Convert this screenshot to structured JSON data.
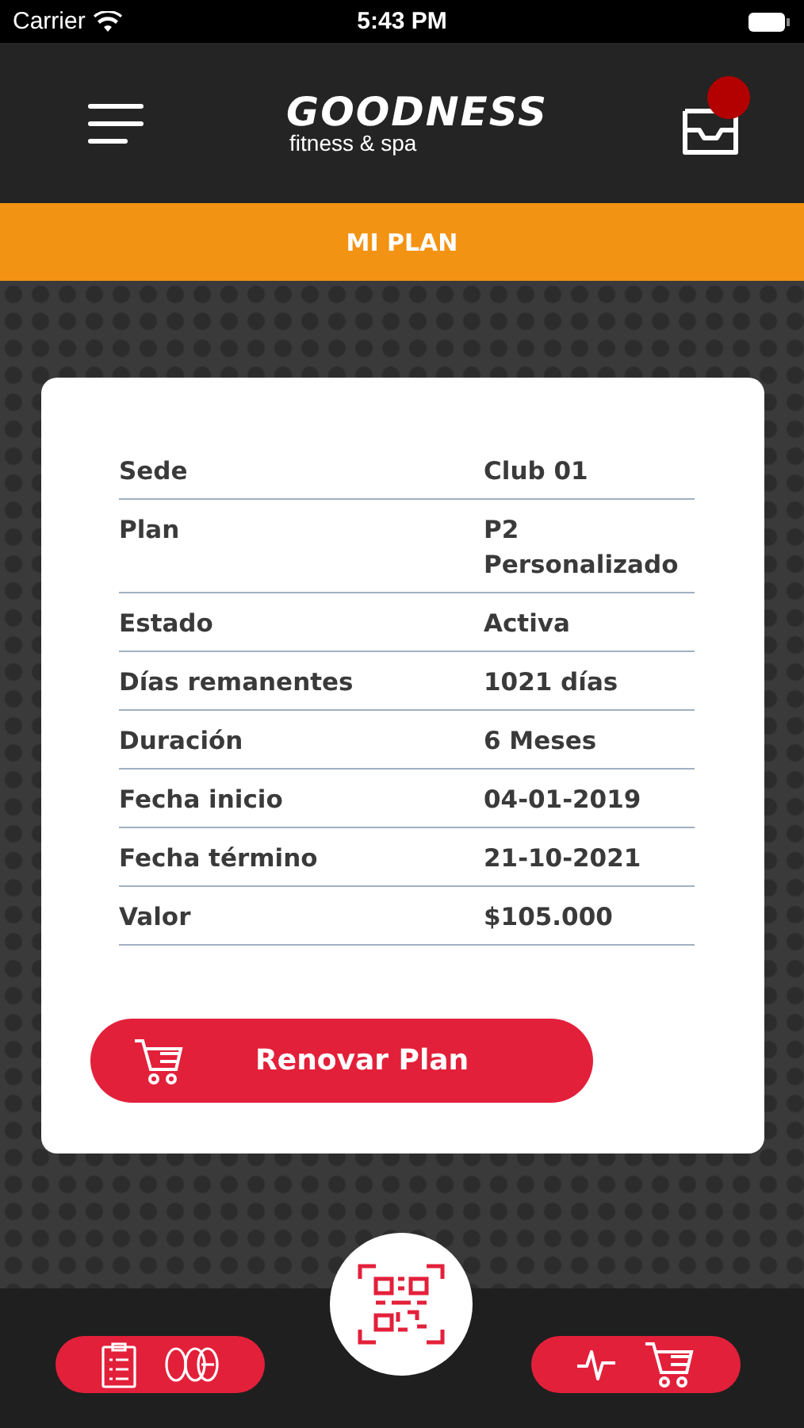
{
  "status_bar": {
    "carrier": "Carrier",
    "time": "5:43 PM"
  },
  "header": {
    "logo": "GOODNESS",
    "tagline": "fitness & spa",
    "inbox": {
      "unread": true
    }
  },
  "title": "MI PLAN",
  "plan_rows": [
    {
      "label": "Sede",
      "value": "Club 01"
    },
    {
      "label": "Plan",
      "value": "P2 Personalizado"
    },
    {
      "label": "Estado",
      "value": "Activa"
    },
    {
      "label": "Días remanentes",
      "value": "1021 días"
    },
    {
      "label": "Duración",
      "value": "6 Meses"
    },
    {
      "label": "Fecha inicio",
      "value": "04-01-2019"
    },
    {
      "label": "Fecha término",
      "value": "21-10-2021"
    },
    {
      "label": "Valor",
      "value": "$105.000"
    }
  ],
  "renew_button": "Renovar Plan"
}
